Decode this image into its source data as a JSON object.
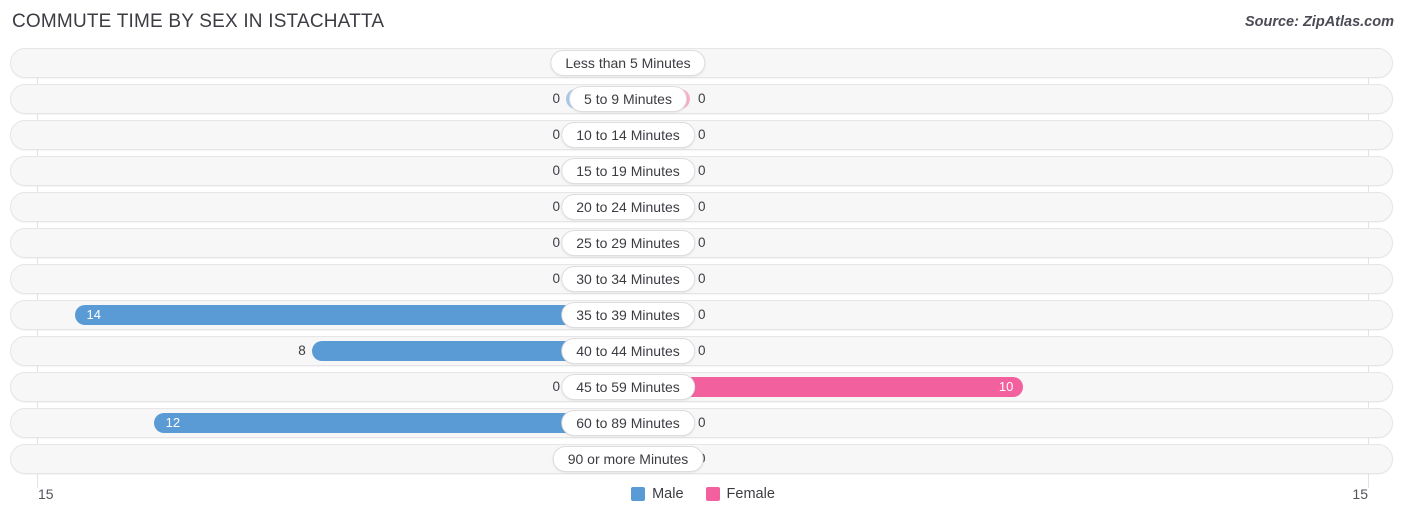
{
  "header": {
    "title": "COMMUTE TIME BY SEX IN ISTACHATTA",
    "source": "Source: ZipAtlas.com"
  },
  "axis": {
    "left_label": "15",
    "right_label": "15"
  },
  "legend": {
    "items": [
      {
        "label": "Male",
        "color": "#5b9bd5",
        "icon": "square-swatch"
      },
      {
        "label": "Female",
        "color": "#f2609e",
        "icon": "square-swatch"
      }
    ]
  },
  "colors": {
    "male": "#5b9bd5",
    "female": "#f2609e",
    "male_zero": "#a8c8e8",
    "female_zero": "#f9afc7",
    "track": "#f7f7f8",
    "gridline": "#e3e3e6"
  },
  "chart_data": {
    "type": "bar",
    "title": "COMMUTE TIME BY SEX IN ISTACHATTA",
    "subtitle": "",
    "orientation": "horizontal-diverging",
    "xlabel": "",
    "ylabel": "",
    "xlim": [
      15,
      15
    ],
    "axis_max": 15,
    "grid": true,
    "legend_position": "bottom-center",
    "categories": [
      "Less than 5 Minutes",
      "5 to 9 Minutes",
      "10 to 14 Minutes",
      "15 to 19 Minutes",
      "20 to 24 Minutes",
      "25 to 29 Minutes",
      "30 to 34 Minutes",
      "35 to 39 Minutes",
      "40 to 44 Minutes",
      "45 to 59 Minutes",
      "60 to 89 Minutes",
      "90 or more Minutes"
    ],
    "series": [
      {
        "name": "Male",
        "color": "#5b9bd5",
        "values": [
          0,
          0,
          0,
          0,
          0,
          0,
          0,
          14,
          8,
          0,
          12,
          0
        ]
      },
      {
        "name": "Female",
        "color": "#f2609e",
        "values": [
          0,
          0,
          0,
          0,
          0,
          0,
          0,
          0,
          0,
          10,
          0,
          0
        ]
      }
    ]
  },
  "rows": [
    {
      "label": "Less than 5 Minutes",
      "male": "0",
      "female": "0"
    },
    {
      "label": "5 to 9 Minutes",
      "male": "0",
      "female": "0"
    },
    {
      "label": "10 to 14 Minutes",
      "male": "0",
      "female": "0"
    },
    {
      "label": "15 to 19 Minutes",
      "male": "0",
      "female": "0"
    },
    {
      "label": "20 to 24 Minutes",
      "male": "0",
      "female": "0"
    },
    {
      "label": "25 to 29 Minutes",
      "male": "0",
      "female": "0"
    },
    {
      "label": "30 to 34 Minutes",
      "male": "0",
      "female": "0"
    },
    {
      "label": "35 to 39 Minutes",
      "male": "14",
      "female": "0"
    },
    {
      "label": "40 to 44 Minutes",
      "male": "8",
      "female": "0"
    },
    {
      "label": "45 to 59 Minutes",
      "male": "0",
      "female": "10"
    },
    {
      "label": "60 to 89 Minutes",
      "male": "12",
      "female": "0"
    },
    {
      "label": "90 or more Minutes",
      "male": "0",
      "female": "0"
    }
  ]
}
